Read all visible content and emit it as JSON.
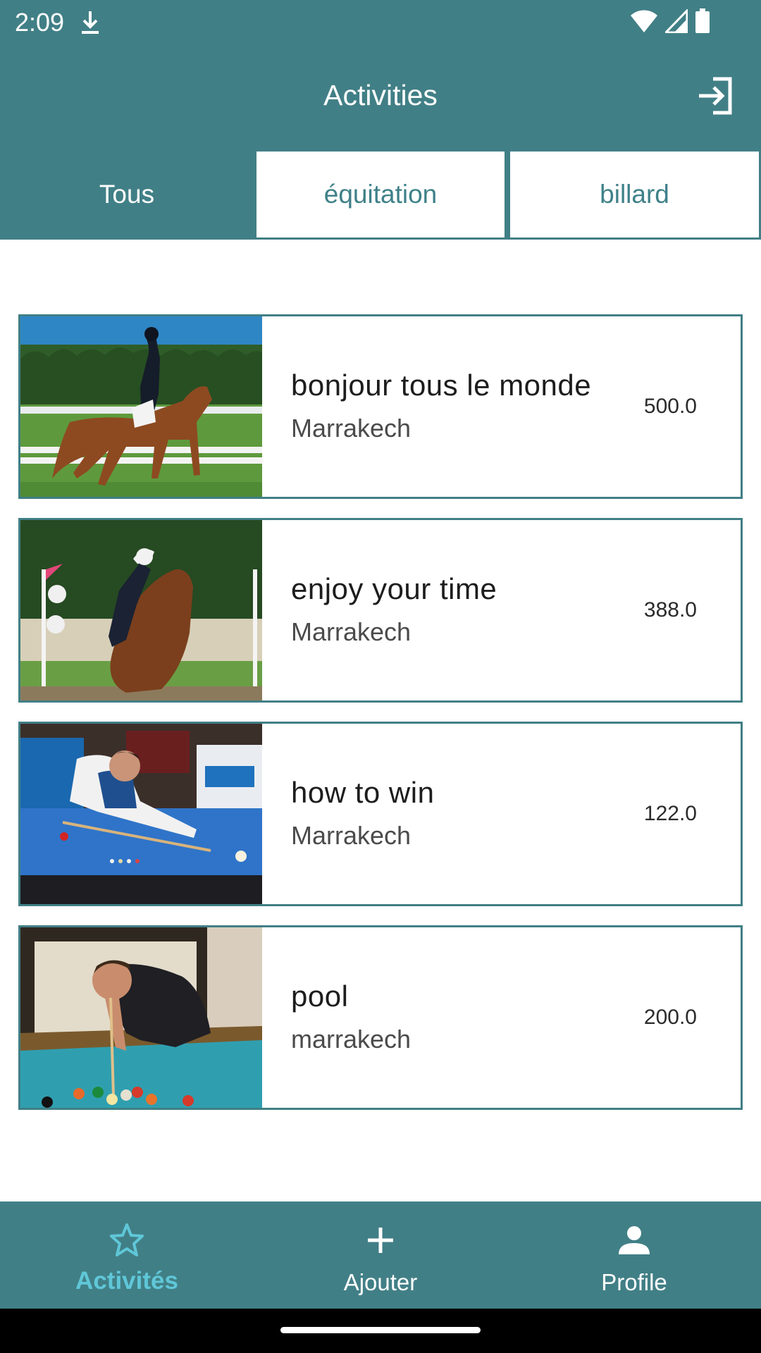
{
  "status_bar": {
    "time": "2:09"
  },
  "app_bar": {
    "title": "Activities",
    "logout_icon": "logout-icon"
  },
  "tabs": [
    {
      "label": "Tous",
      "selected": true
    },
    {
      "label": "équitation",
      "selected": false
    },
    {
      "label": "billard",
      "selected": false
    }
  ],
  "activities": [
    {
      "title": "bonjour tous le monde",
      "city": "Marrakech",
      "price": "500.0",
      "image": "dressage-horse-photo"
    },
    {
      "title": "enjoy your time",
      "city": "Marrakech",
      "price": "388.0",
      "image": "eventing-horse-jump-photo"
    },
    {
      "title": "how to win",
      "city": "Marrakech",
      "price": "122.0",
      "image": "billiards-player-photo"
    },
    {
      "title": "pool",
      "city": "marrakech",
      "price": "200.0",
      "image": "pool-player-photo"
    }
  ],
  "bottom_nav": [
    {
      "label": "Activités",
      "icon": "star-icon",
      "active": true
    },
    {
      "label": "Ajouter",
      "icon": "plus-icon",
      "active": false
    },
    {
      "label": "Profile",
      "icon": "person-icon",
      "active": false
    }
  ],
  "colors": {
    "primary": "#417f86",
    "active_nav": "#5fc7d8",
    "tab_text": "#3f8189"
  }
}
